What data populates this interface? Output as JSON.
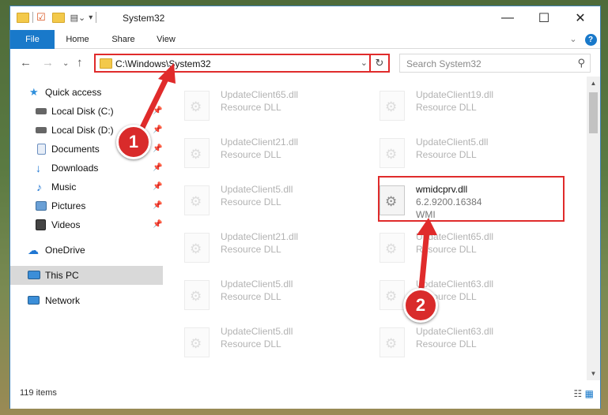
{
  "window": {
    "title": "System32",
    "minimize": "—",
    "maximize": "☐",
    "close": "✕"
  },
  "ribbon": {
    "tabs": [
      "File",
      "Home",
      "Share",
      "View"
    ],
    "expand": "⌄",
    "help": "?"
  },
  "address": {
    "path": "C:\\Windows\\System32",
    "dropdown": "⌄",
    "refresh": "↻"
  },
  "search": {
    "placeholder": "Search System32",
    "icon": "search-icon"
  },
  "nav": {
    "back": "←",
    "forward": "→",
    "recent": "⌄",
    "up": "↑"
  },
  "sidebar": {
    "items": [
      {
        "label": "Quick access",
        "icon": "star-icon",
        "color": "#2f8fdc"
      },
      {
        "label": "Local Disk (C:)",
        "icon": "drive-icon",
        "color": "#555555"
      },
      {
        "label": "Local Disk (D:)",
        "icon": "drive-icon",
        "color": "#555555"
      },
      {
        "label": "Documents",
        "icon": "document-icon",
        "color": "#6b8fc0"
      },
      {
        "label": "Downloads",
        "icon": "download-icon",
        "color": "#1f76d2"
      },
      {
        "label": "Music",
        "icon": "music-icon",
        "color": "#1f76d2"
      },
      {
        "label": "Pictures",
        "icon": "pictures-icon",
        "color": "#6aa0d6"
      },
      {
        "label": "Videos",
        "icon": "video-icon",
        "color": "#444444"
      },
      {
        "label": "OneDrive",
        "icon": "cloud-icon",
        "color": "#1f76d2"
      },
      {
        "label": "This PC",
        "icon": "computer-icon",
        "color": "#3b8ed8"
      },
      {
        "label": "Network",
        "icon": "network-icon",
        "color": "#3b8ed8"
      }
    ]
  },
  "files": [
    {
      "name": "UpdateClient65.dll",
      "type": "Resource DLL"
    },
    {
      "name": "UpdateClient19.dll",
      "type": "Resource DLL"
    },
    {
      "name": "UpdateClient21.dll",
      "type": "Resource DLL"
    },
    {
      "name": "UpdateClient5.dll",
      "type": "Resource DLL"
    },
    {
      "name": "UpdateClient5.dll",
      "type": "Resource DLL"
    },
    {
      "name": "wmidcprv.dll",
      "version": "6.2.9200.16384",
      "type": "WMI"
    },
    {
      "name": "UpdateClient21.dll",
      "type": "Resource DLL"
    },
    {
      "name": "UpdateClient65.dll",
      "type": "Resource DLL"
    },
    {
      "name": "UpdateClient5.dll",
      "type": "Resource DLL"
    },
    {
      "name": "UpdateClient63.dll",
      "type": "Resource DLL"
    },
    {
      "name": "UpdateClient5.dll",
      "type": "Resource DLL"
    },
    {
      "name": "UpdateClient63.dll",
      "type": "Resource DLL"
    }
  ],
  "status": {
    "count": "119 items"
  },
  "annotations": {
    "step1": "1",
    "step2": "2",
    "color": "#e02b2b"
  }
}
